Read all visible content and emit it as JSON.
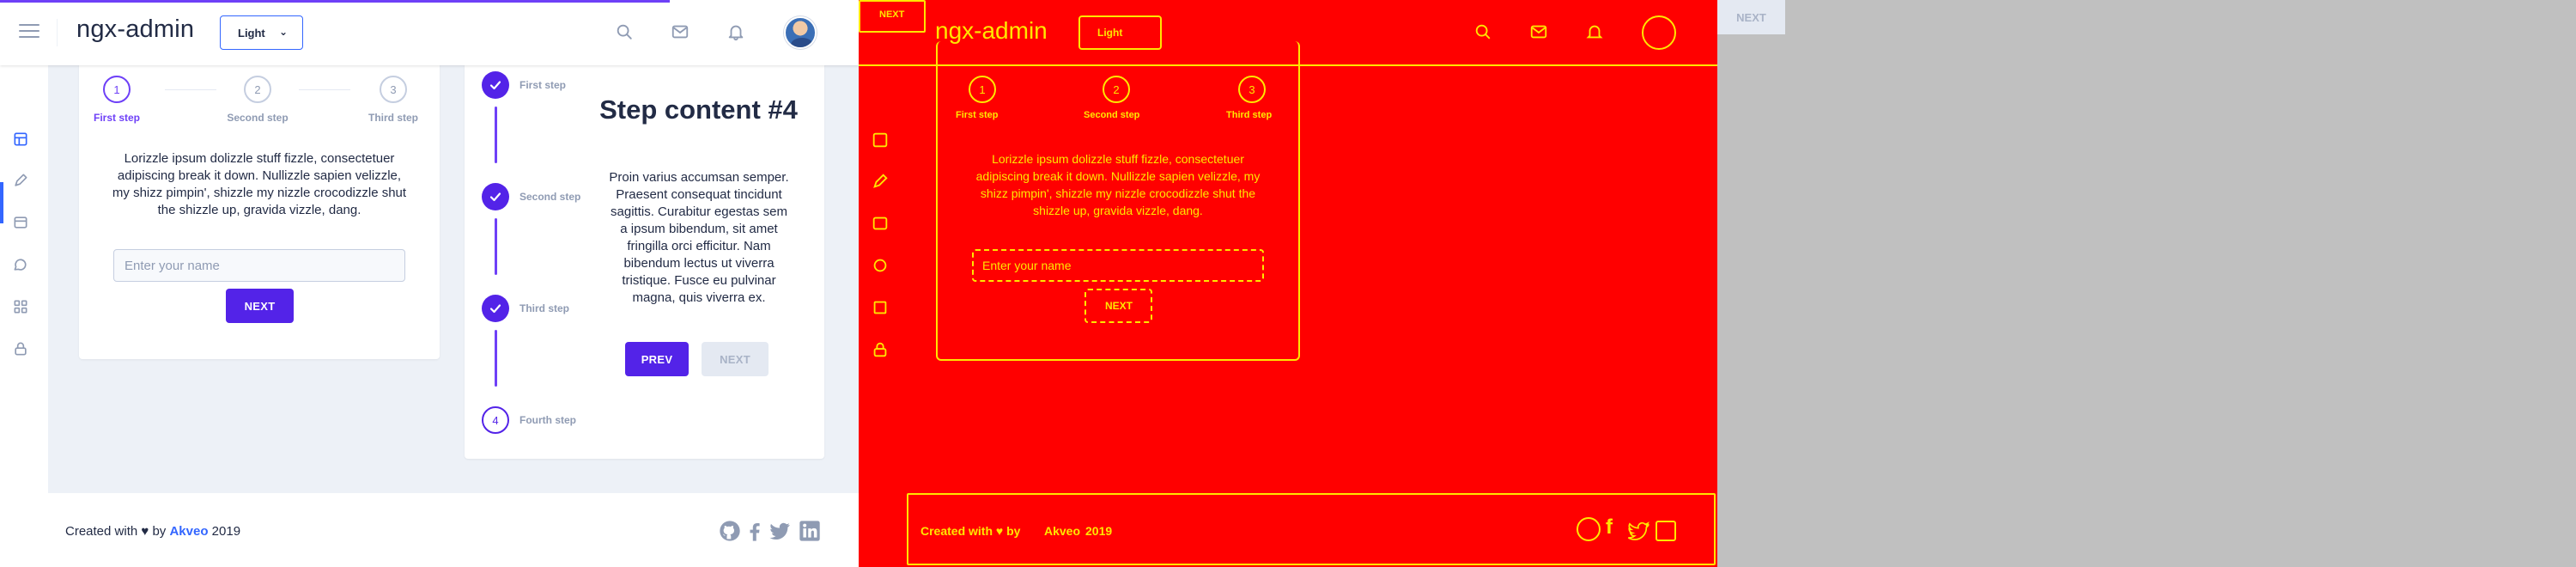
{
  "header": {
    "brand": "ngx-admin",
    "theme_selected": "Light"
  },
  "horizontal_stepper": {
    "steps": [
      {
        "number": "1",
        "label": "First step"
      },
      {
        "number": "2",
        "label": "Second step"
      },
      {
        "number": "3",
        "label": "Third step"
      }
    ],
    "text": "Lorizzle ipsum dolizzle stuff fizzle, consectetuer adipiscing break it down. Nullizzle sapien velizzle, my shizz pimpin', shizzle my nizzle crocodizzle shut the shizzle up, gravida vizzle, dang.",
    "input_placeholder": "Enter your name",
    "next_label": "NEXT"
  },
  "vertical_stepper": {
    "steps": [
      {
        "label": "First step",
        "state": "done"
      },
      {
        "label": "Second step",
        "state": "done"
      },
      {
        "label": "Third step",
        "state": "done"
      },
      {
        "label": "Fourth step",
        "state": "pending",
        "number": "4"
      }
    ],
    "content_title": "Step content #4",
    "content_text": "Proin varius accumsan semper. Praesent consequat tincidunt sagittis. Curabitur egestas sem a ipsum bibendum, sit amet fringilla orci efficitur. Nam bibendum lectus ut viverra tristique. Fusce eu pulvinar magna, quis viverra ex.",
    "prev_label": "PREV",
    "next_label": "NEXT"
  },
  "footer": {
    "prefix": "Created with ♥ by",
    "company": "Akveo",
    "year": "2019"
  },
  "edge_overlay": {
    "badge": "NEXT"
  },
  "right_pane": {
    "next_label": "NEXT"
  },
  "icons": [
    "menu-icon",
    "search-icon",
    "email-icon",
    "bell-icon",
    "layout-icon",
    "edit-icon",
    "table-icon",
    "chat-icon",
    "grid-icon",
    "lock-icon",
    "github-icon",
    "facebook-icon",
    "twitter-icon",
    "linkedin-icon",
    "check-icon"
  ],
  "colors": {
    "primary": "#5323e8",
    "accent_blue": "#3366ff",
    "edge_background": "#ff0000",
    "edge_lines": "#ffe600",
    "right_background": "#c0c0c0"
  }
}
